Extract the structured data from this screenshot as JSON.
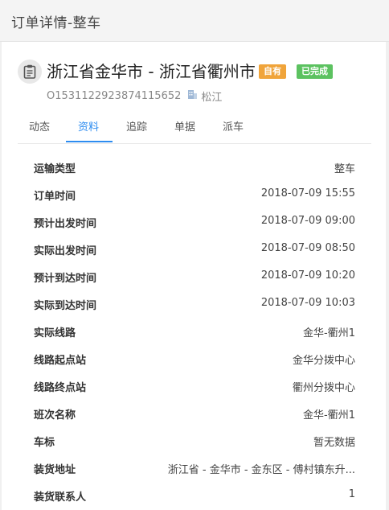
{
  "header": {
    "title": "订单详情-整车"
  },
  "order": {
    "route": "浙江省金华市 - 浙江省衢州市",
    "badge_own": "自有",
    "badge_status": "已完成",
    "order_no": "O1531122923874115652",
    "company": "松江"
  },
  "tabs": [
    {
      "label": "动态"
    },
    {
      "label": "资料"
    },
    {
      "label": "追踪"
    },
    {
      "label": "单据"
    },
    {
      "label": "派车"
    }
  ],
  "details": [
    {
      "label": "运输类型",
      "value": "整车"
    },
    {
      "label": "订单时间",
      "value": "2018-07-09 15:55"
    },
    {
      "label": "预计出发时间",
      "value": "2018-07-09 09:00"
    },
    {
      "label": "实际出发时间",
      "value": "2018-07-09 08:50"
    },
    {
      "label": "预计到达时间",
      "value": "2018-07-09 10:20"
    },
    {
      "label": "实际到达时间",
      "value": "2018-07-09 10:03"
    },
    {
      "label": "实际线路",
      "value": "金华-衢州1"
    },
    {
      "label": "线路起点站",
      "value": "金华分拨中心"
    },
    {
      "label": "线路终点站",
      "value": "衢州分拨中心"
    },
    {
      "label": "班次名称",
      "value": "金华-衢州1"
    },
    {
      "label": "车标",
      "value": "暂无数据"
    },
    {
      "label": "装货地址",
      "value": "浙江省 - 金华市 - 金东区 - 傅村镇东升..."
    },
    {
      "label": "装货联系人",
      "value": "1"
    }
  ],
  "colors": {
    "accent": "#2d8cf0",
    "badge_own": "#f0a43a",
    "badge_done": "#5cc260"
  },
  "icons": {
    "order": "clipboard-icon",
    "company": "building-icon"
  }
}
